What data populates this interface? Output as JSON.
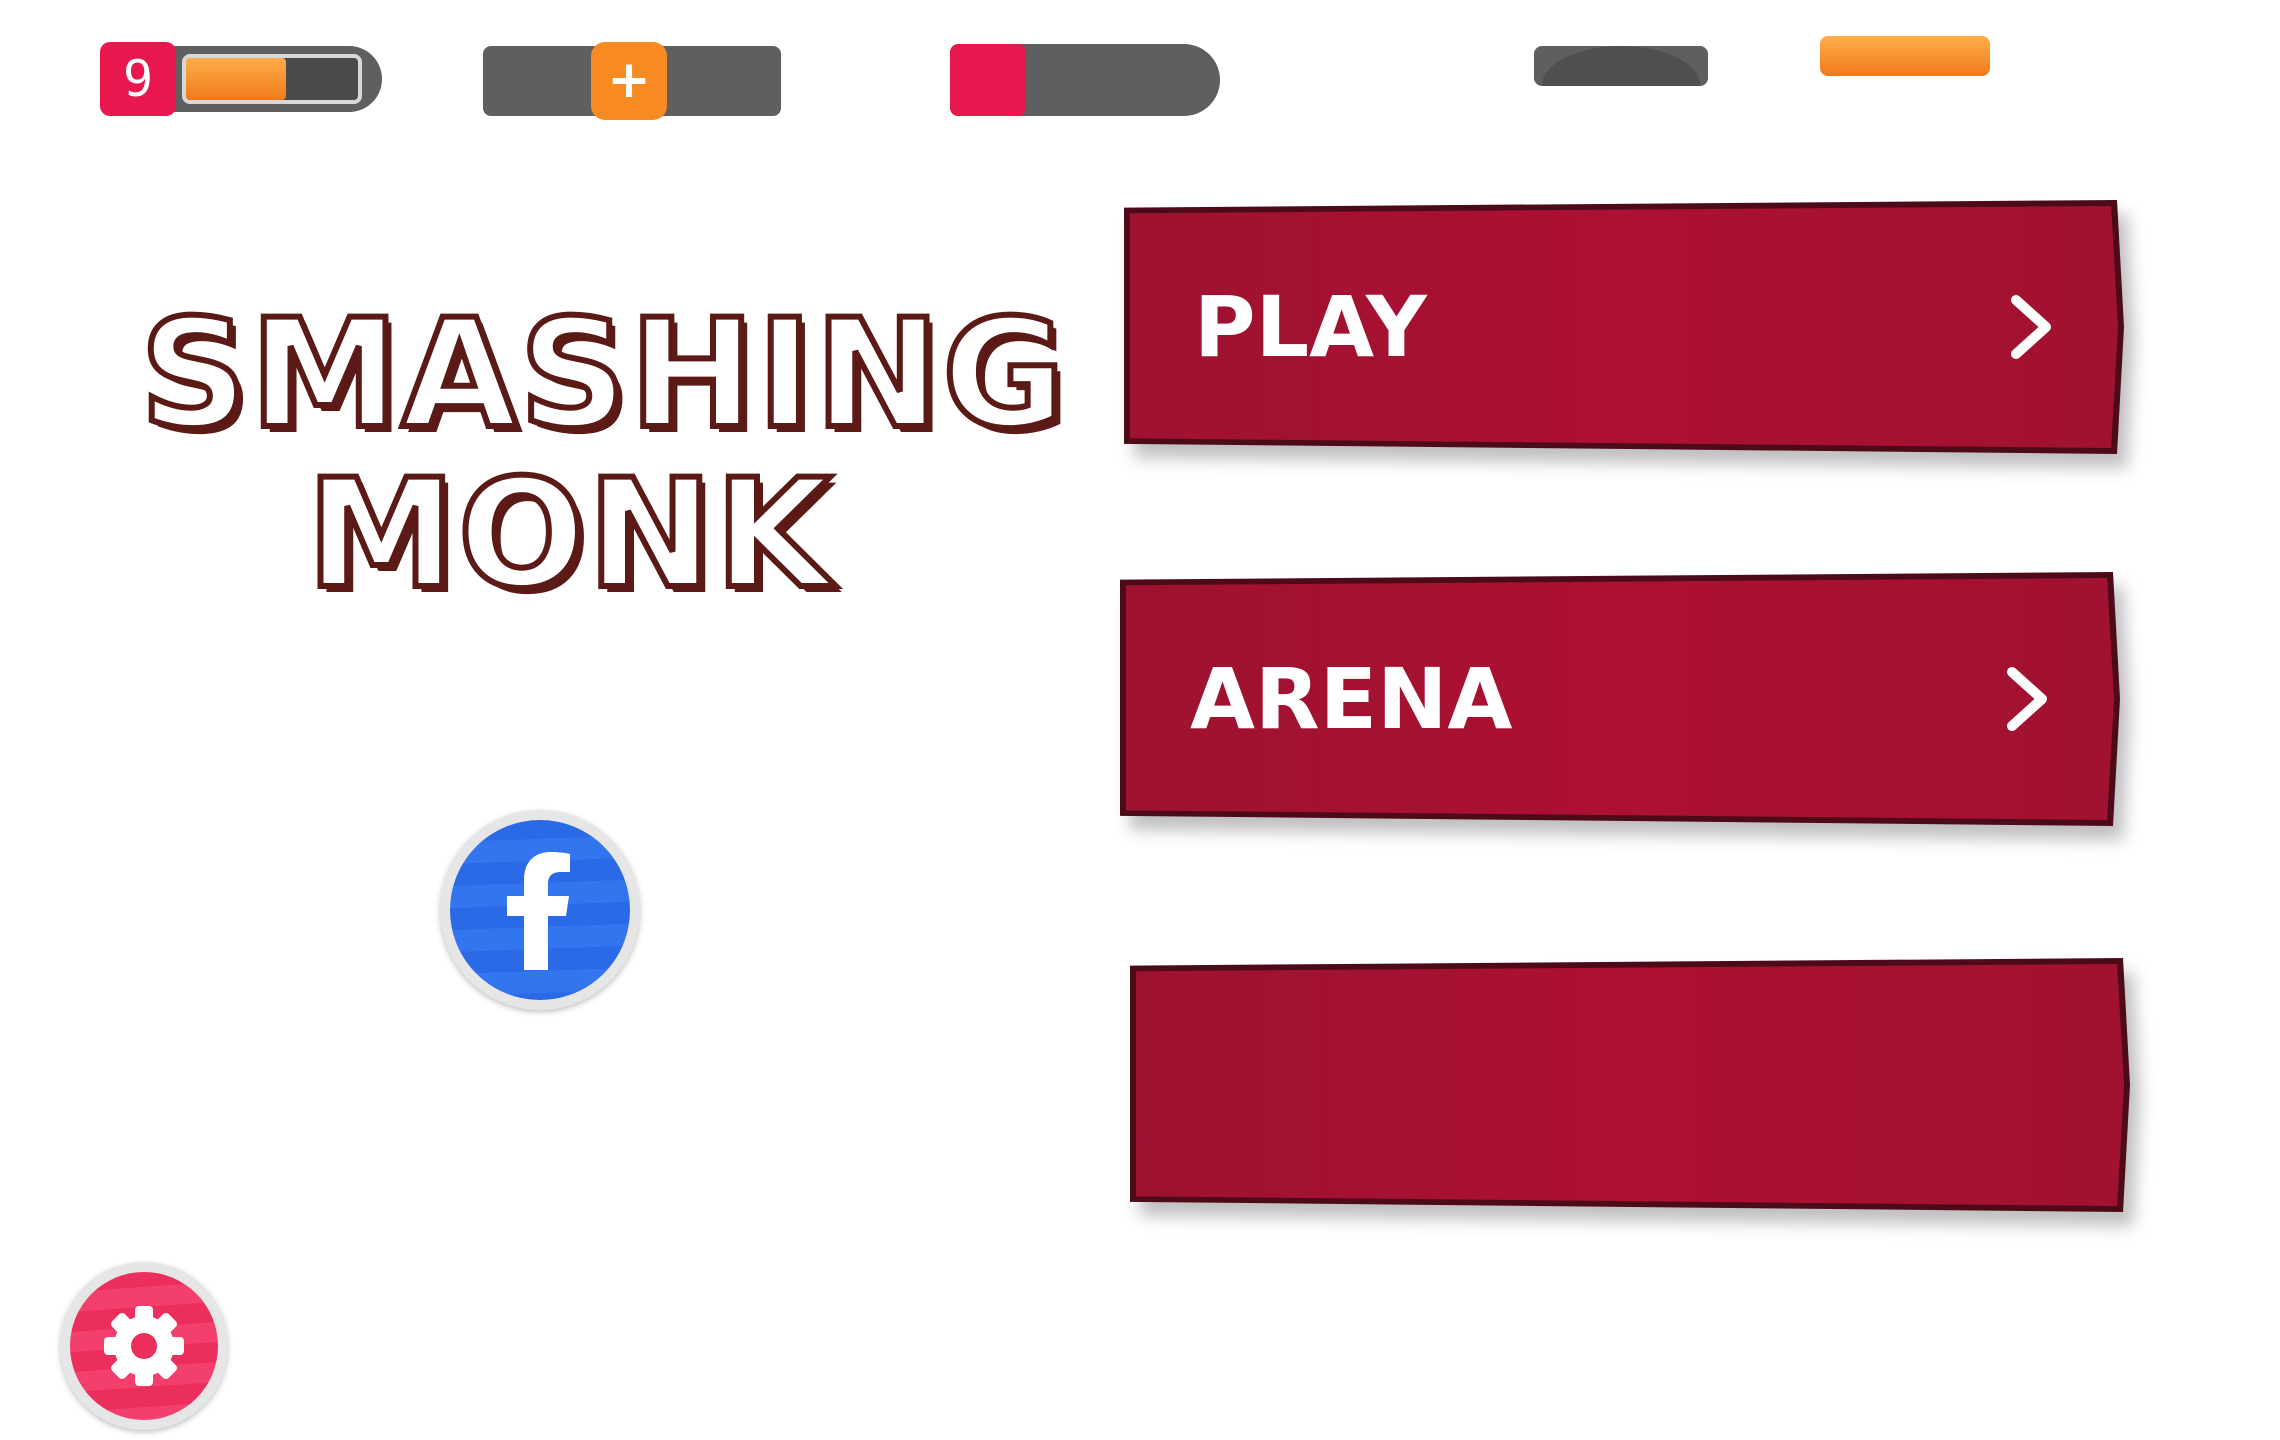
{
  "hud": {
    "level_number": "9",
    "level_progress": 0.58
  },
  "title": {
    "line1": "SMASHING",
    "line2": "MONK"
  },
  "menu": {
    "play_label": "PLAY",
    "arena_label": "ARENA",
    "third_label": ""
  },
  "icons": {
    "facebook": "facebook-icon",
    "settings": "gear-icon",
    "chevron": "chevron-right-icon",
    "plus": "plus-icon"
  },
  "colors": {
    "button_red": "#a8102f",
    "badge_red": "#e8184e",
    "orange": "#f78a20",
    "facebook_blue": "#2b6ae6",
    "title_outline": "#5b1a16"
  }
}
